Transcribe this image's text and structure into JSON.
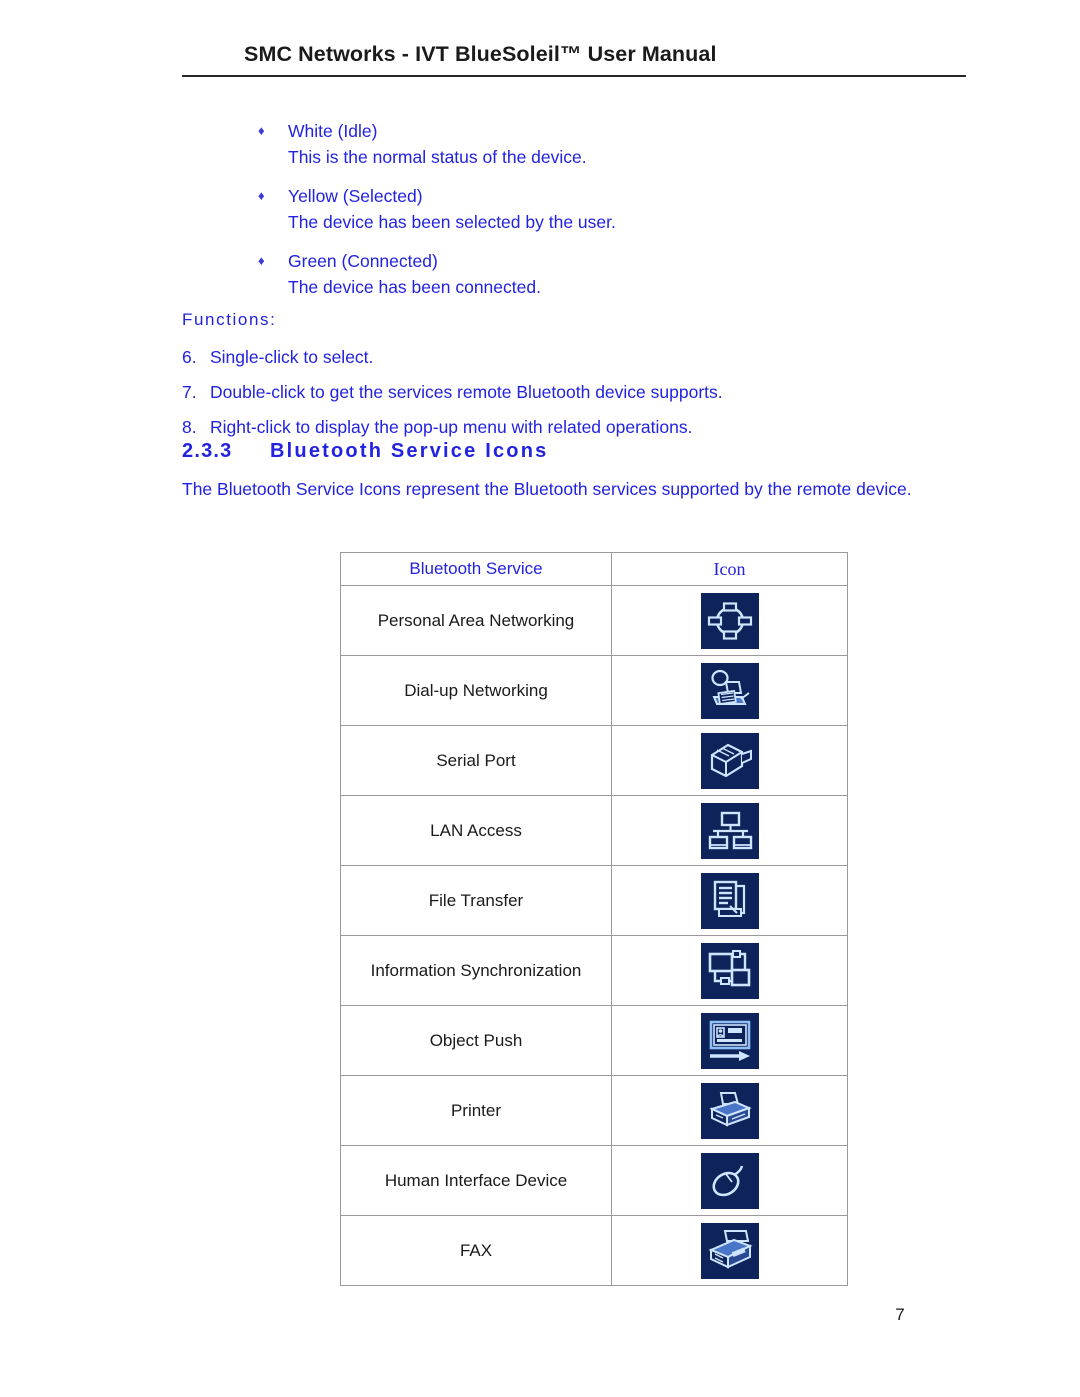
{
  "header": {
    "title": "SMC Networks - IVT BlueSoleil™ User Manual"
  },
  "status_bullets": {
    "marker": "♦",
    "items": [
      {
        "title": "White (Idle)",
        "desc": "This is the normal status of the device."
      },
      {
        "title": "Yellow (Selected)",
        "desc": "The device has been selected by the user."
      },
      {
        "title": "Green (Connected)",
        "desc": "The device has been connected."
      }
    ]
  },
  "functions": {
    "label": "Functions:",
    "items": [
      {
        "num": "6.",
        "text": "Single-click to select."
      },
      {
        "num": "7.",
        "text": "Double-click to get the services remote Bluetooth device supports."
      },
      {
        "num": "8.",
        "text": "Right-click to display the pop-up menu with related operations."
      }
    ]
  },
  "section": {
    "number": "2.3.3",
    "title": "Bluetooth Service Icons",
    "intro": "The Bluetooth Service Icons represent the Bluetooth services supported by the remote device."
  },
  "table": {
    "headers": [
      "Bluetooth Service",
      "Icon"
    ],
    "rows": [
      {
        "service": "Personal Area Networking",
        "icon": "personal-area-networking-icon"
      },
      {
        "service": "Dial-up Networking",
        "icon": "dial-up-networking-icon"
      },
      {
        "service": "Serial Port",
        "icon": "serial-port-icon"
      },
      {
        "service": "LAN Access",
        "icon": "lan-access-icon"
      },
      {
        "service": "File Transfer",
        "icon": "file-transfer-icon"
      },
      {
        "service": "Information Synchronization",
        "icon": "information-synchronization-icon"
      },
      {
        "service": "Object Push",
        "icon": "object-push-icon"
      },
      {
        "service": "Printer",
        "icon": "printer-icon"
      },
      {
        "service": "Human Interface Device",
        "icon": "human-interface-device-icon"
      },
      {
        "service": "FAX",
        "icon": "fax-icon"
      }
    ]
  },
  "footer": {
    "page_number": "7"
  },
  "colors": {
    "body_text_blue": "#2222e0",
    "black_text": "#1a1a1a",
    "icon_tile_bg": "#0d2359",
    "icon_glyph": "#cfe4ff",
    "table_border": "#9a9a9a"
  }
}
